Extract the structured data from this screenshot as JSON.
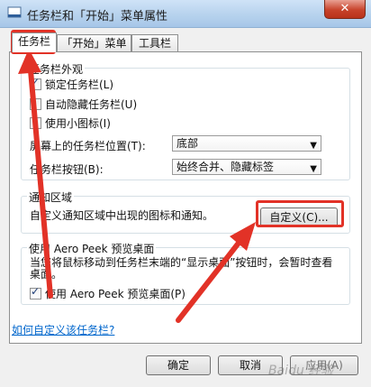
{
  "window": {
    "title": "任务栏和「开始」菜单属性",
    "close_label": "✕"
  },
  "tabs": [
    {
      "label": "任务栏"
    },
    {
      "label": "「开始」菜单"
    },
    {
      "label": "工具栏"
    }
  ],
  "appearance": {
    "title": "任务栏外观",
    "lock_taskbar": "锁定任务栏(L)",
    "auto_hide": "自动隐藏任务栏(U)",
    "small_icons": "使用小图标(I)",
    "position_label": "屏幕上的任务栏位置(T):",
    "position_value": "底部",
    "buttons_label": "任务栏按钮(B):",
    "buttons_value": "始终合并、隐藏标签"
  },
  "notification": {
    "title": "通知区域",
    "description": "自定义通知区域中出现的图标和通知。",
    "customize_button": "自定义(C)..."
  },
  "aero_peek": {
    "title": "使用 Aero Peek 预览桌面",
    "description": "当您将鼠标移动到任务栏末端的“显示桌面”按钮时，会暂时查看桌面。",
    "checkbox_label": "使用 Aero Peek 预览桌面(P)"
  },
  "help_link": "如何自定义该任务栏?",
  "footer": {
    "ok": "确定",
    "cancel": "取消",
    "apply": "应用(A)"
  },
  "watermark": "Baidu 经验",
  "colors": {
    "annotation_red": "#e23227",
    "link": "#0066cc"
  }
}
